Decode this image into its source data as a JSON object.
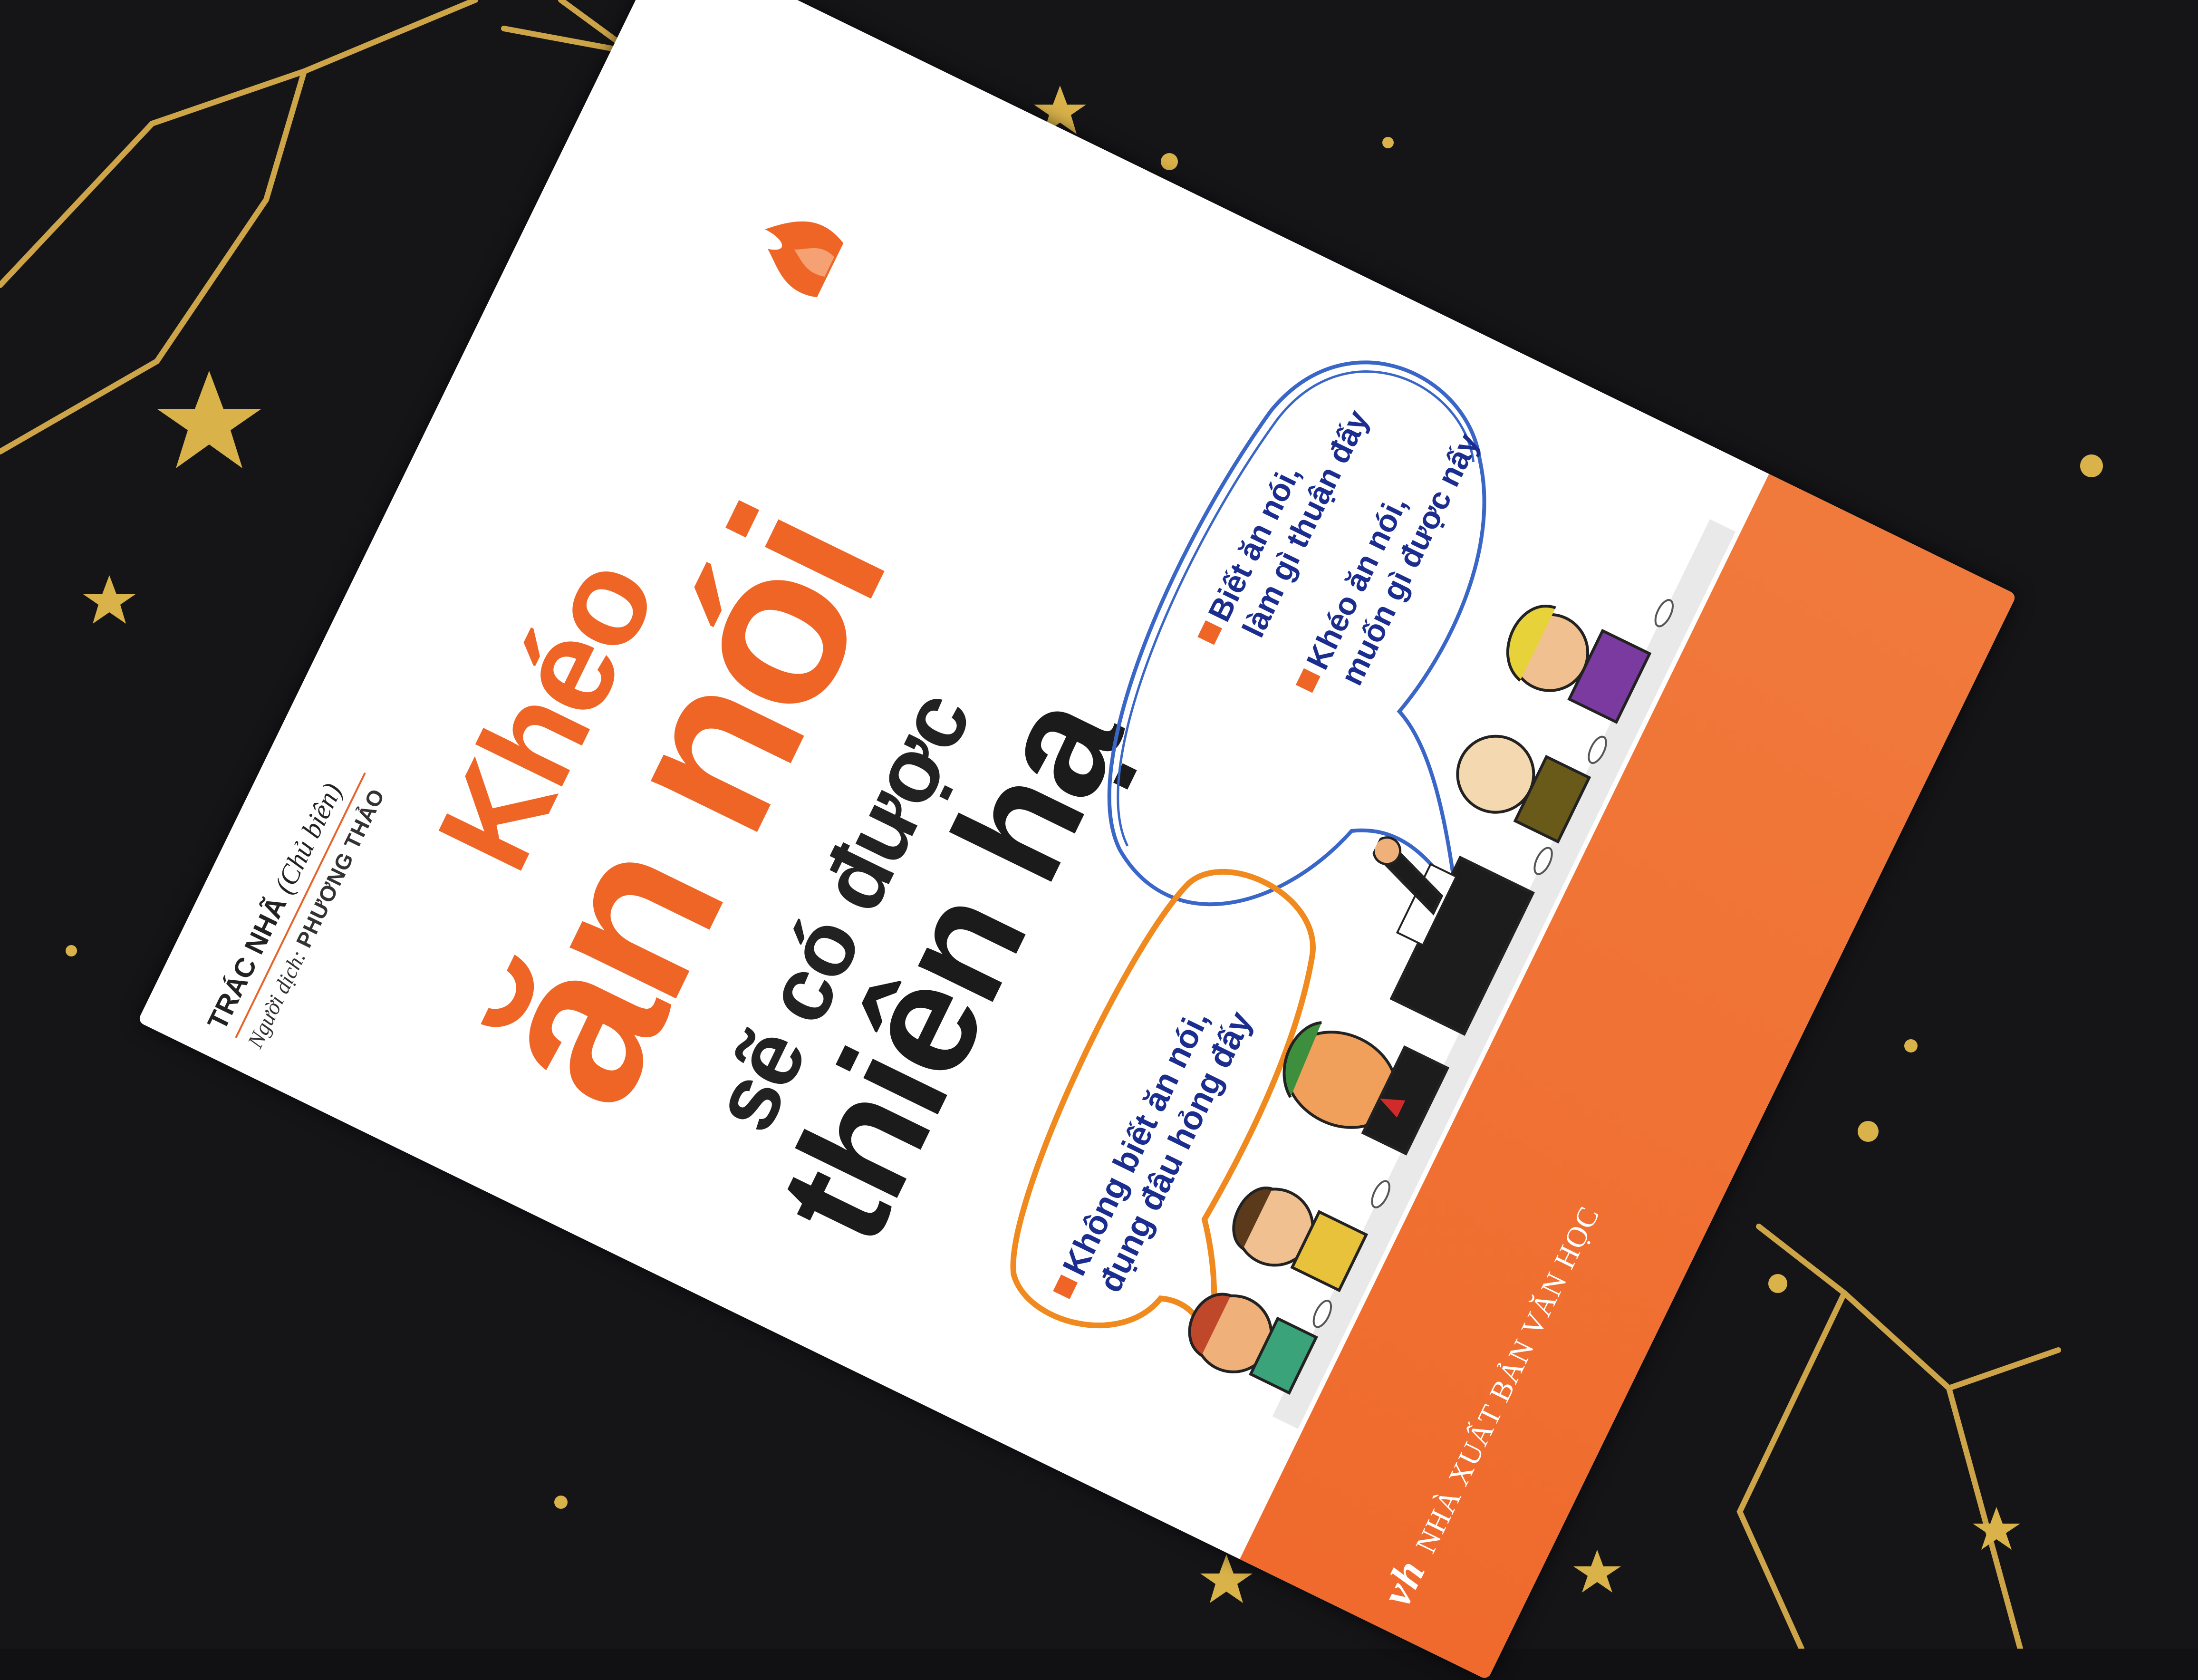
{
  "book": {
    "title_line1": "Khéo",
    "title_line2": "ăn nói",
    "title_line3": "sẽ có được",
    "title_line4": "thiên hạ",
    "author_name": "TRÁC NHÃ",
    "author_role": "(Chủ biên)",
    "translator_label": "Người dịch:",
    "translator_name": "PHƯƠNG THẢO",
    "quote_1_line1": "Không biết ăn nói,",
    "quote_1_line2": "đụng đâu hỏng đấy",
    "quote_2_line1": "Biết ăn nói,",
    "quote_2_line2": "làm gì thuận đấy",
    "quote_3_line1": "Khéo ăn nói,",
    "quote_3_line2": "muốn gì được nấy",
    "publisher_logo": "vh",
    "publisher_name": "NHÀ XUẤT BẢN VĂN HỌC"
  },
  "colors": {
    "accent_orange": "#ee6526",
    "title_dark": "#1b1b1b",
    "quote_blue": "#1b2d8e",
    "background": "#151518",
    "star_gold": "#d9b24a"
  }
}
